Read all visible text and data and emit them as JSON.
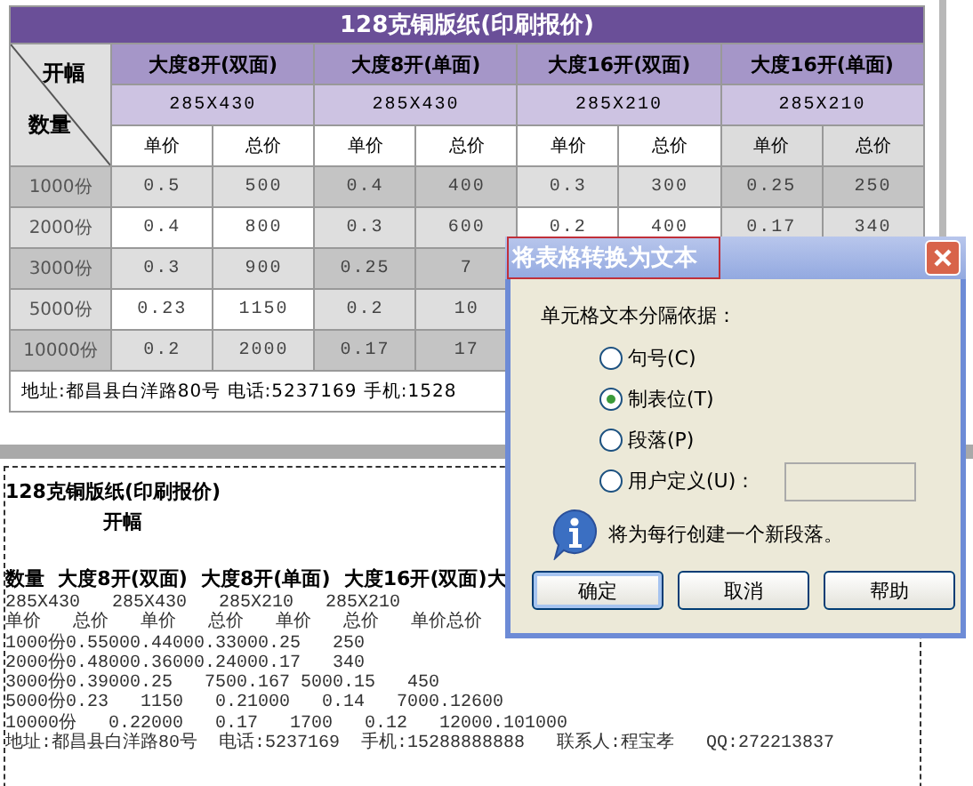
{
  "table": {
    "title": "128克铜版纸(印刷报价)",
    "corner_top": "开幅",
    "corner_bottom": "数量",
    "groups": [
      {
        "name": "大度8开(双面)",
        "size": "285X430"
      },
      {
        "name": "大度8开(单面)",
        "size": "285X430"
      },
      {
        "name": "大度16开(双面)",
        "size": "285X210"
      },
      {
        "name": "大度16开(单面)",
        "size": "285X210"
      }
    ],
    "subheaders": [
      "单价",
      "总价",
      "单价",
      "总价",
      "单价",
      "总价",
      "单价",
      "总价"
    ],
    "rows": [
      {
        "label": "1000份",
        "cells": [
          "0.5",
          "500",
          "0.4",
          "400",
          "0.3",
          "300",
          "0.25",
          "250"
        ]
      },
      {
        "label": "2000份",
        "cells": [
          "0.4",
          "800",
          "0.3",
          "600",
          "0.2",
          "400",
          "0.17",
          "340"
        ]
      },
      {
        "label": "3000份",
        "cells": [
          "0.3",
          "900",
          "0.25",
          "7"
        ]
      },
      {
        "label": "5000份",
        "cells": [
          "0.23",
          "1150",
          "0.2",
          "10"
        ]
      },
      {
        "label": "10000份",
        "cells": [
          "0.2",
          "2000",
          "0.17",
          "17"
        ]
      }
    ],
    "footer": "地址:都昌县白洋路80号  电话:5237169  手机:1528"
  },
  "document_text": [
    {
      "kind": "heading",
      "text": "128克铜版纸(印刷报价)"
    },
    {
      "kind": "subheading",
      "text": "开幅"
    },
    {
      "kind": "heading",
      "text": "数量  大度8开(双面)  大度8开(单面)  大度16开(双面)大"
    },
    {
      "kind": "plain",
      "text": "285X430   285X430   285X210   285X210"
    },
    {
      "kind": "plain",
      "text": "单价   总价   单价   总价   单价   总价   单价总价"
    },
    {
      "kind": "plain",
      "text": "1000份0.55000.44000.33000.25   250"
    },
    {
      "kind": "plain",
      "text": "2000份0.48000.36000.24000.17   340"
    },
    {
      "kind": "plain",
      "text": "3000份0.39000.25   7500.167 5000.15   450"
    },
    {
      "kind": "plain",
      "text": "5000份0.23   1150   0.21000   0.14   7000.12600"
    },
    {
      "kind": "plain",
      "text": "10000份   0.22000   0.17   1700   0.12   12000.101000"
    },
    {
      "kind": "plain",
      "text": "地址:都昌县白洋路80号  电话:5237169  手机:15288888888   联系人:程宝孝   QQ:272213837"
    }
  ],
  "dialog": {
    "title": "将表格转换为文本",
    "title_highlighted": true,
    "prompt": "单元格文本分隔依据：",
    "options": [
      {
        "kind": "plain",
        "label": "句号(C)",
        "selected": false
      },
      {
        "kind": "plain",
        "label": "制表位(T)",
        "selected": true
      },
      {
        "kind": "plain",
        "label": "段落(P)",
        "selected": false
      },
      {
        "kind": "custom",
        "label": "用户定义(U)：",
        "selected": false
      }
    ],
    "info": "将为每行创建一个新段落。",
    "buttons": [
      {
        "label": "确定",
        "default": true
      },
      {
        "label": "取消",
        "default": false
      },
      {
        "label": "帮助",
        "default": false
      }
    ]
  }
}
